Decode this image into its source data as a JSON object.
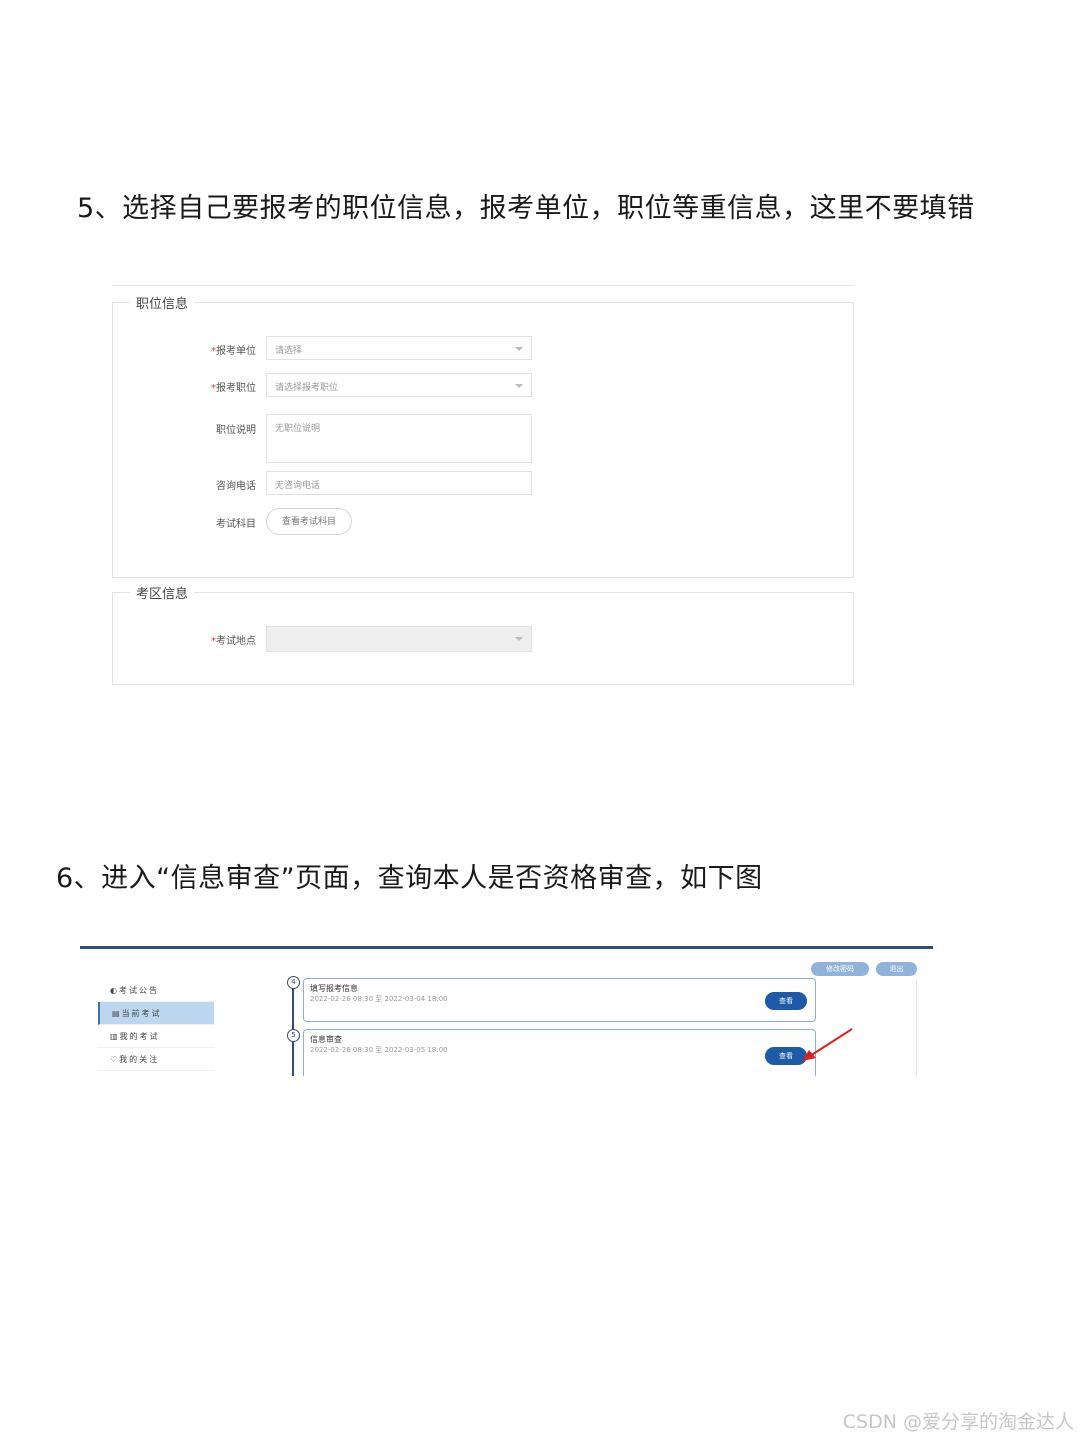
{
  "step5": {
    "heading": "5、选择自己要报考的职位信息，报考单位，职位等重信息，这里不要填错"
  },
  "form": {
    "section_position_title": "职位信息",
    "fields": [
      {
        "required": "*",
        "label": "报考单位",
        "value": "请选择"
      },
      {
        "required": "*",
        "label": "报考职位",
        "value": "请选择报考职位"
      },
      {
        "required": "",
        "label": "职位说明",
        "value": "无职位说明"
      },
      {
        "required": "",
        "label": "咨询电话",
        "value": "无咨询电话"
      },
      {
        "required": "",
        "label": "考试科目",
        "button": "查看考试科目"
      }
    ],
    "section_area_title": "考区信息",
    "area_field": {
      "required": "*",
      "label": "考试地点",
      "value": ""
    }
  },
  "step6": {
    "heading": "6、进入“信息审查”页面，查询本人是否资格审查，如下图"
  },
  "review": {
    "header_buttons": [
      "修改密码",
      "退出"
    ],
    "sidebar": [
      {
        "icon": "◐",
        "label": "考试公告"
      },
      {
        "icon": "▤",
        "label": "当前考试"
      },
      {
        "icon": "▥",
        "label": "我的考试"
      },
      {
        "icon": "♡",
        "label": "我的关注"
      }
    ],
    "steps": [
      {
        "num": "4",
        "title": "填写报考信息",
        "time": "2022-02-26 08:30 至 2022-03-04 18:00",
        "button": "查看"
      },
      {
        "num": "5",
        "title": "信息审查",
        "time": "2022-02-26 08:30 至 2022-03-05 18:00",
        "button": "查看"
      }
    ]
  },
  "watermark": "CSDN @爱分享的淘金达人",
  "colors": {
    "accent": "#1e5aa8",
    "arrow": "#e02020",
    "required": "#e33333"
  }
}
